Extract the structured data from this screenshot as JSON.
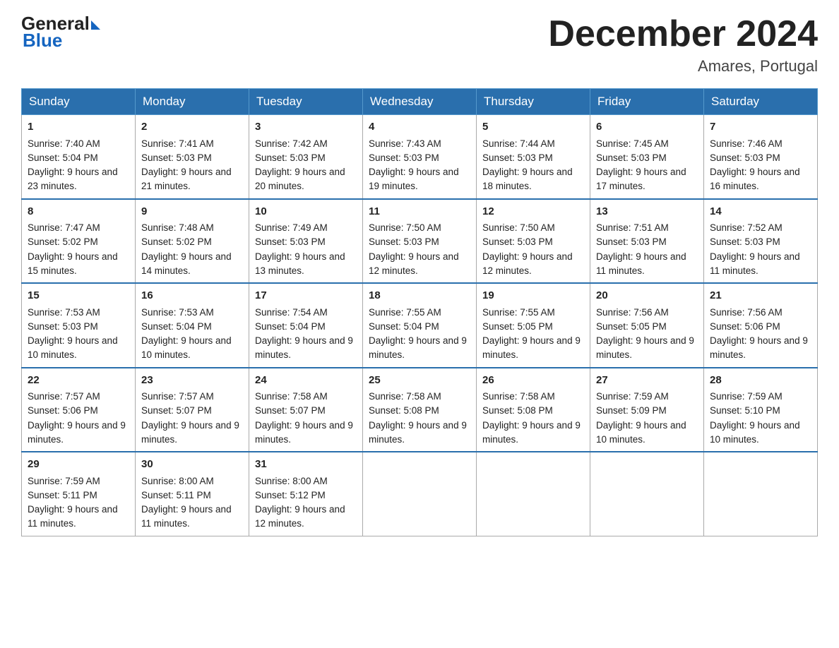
{
  "header": {
    "logo_general": "General",
    "logo_blue": "Blue",
    "month_title": "December 2024",
    "location": "Amares, Portugal"
  },
  "days_of_week": [
    "Sunday",
    "Monday",
    "Tuesday",
    "Wednesday",
    "Thursday",
    "Friday",
    "Saturday"
  ],
  "weeks": [
    [
      {
        "day": 1,
        "sunrise": "7:40 AM",
        "sunset": "5:04 PM",
        "daylight": "9 hours and 23 minutes."
      },
      {
        "day": 2,
        "sunrise": "7:41 AM",
        "sunset": "5:03 PM",
        "daylight": "9 hours and 21 minutes."
      },
      {
        "day": 3,
        "sunrise": "7:42 AM",
        "sunset": "5:03 PM",
        "daylight": "9 hours and 20 minutes."
      },
      {
        "day": 4,
        "sunrise": "7:43 AM",
        "sunset": "5:03 PM",
        "daylight": "9 hours and 19 minutes."
      },
      {
        "day": 5,
        "sunrise": "7:44 AM",
        "sunset": "5:03 PM",
        "daylight": "9 hours and 18 minutes."
      },
      {
        "day": 6,
        "sunrise": "7:45 AM",
        "sunset": "5:03 PM",
        "daylight": "9 hours and 17 minutes."
      },
      {
        "day": 7,
        "sunrise": "7:46 AM",
        "sunset": "5:03 PM",
        "daylight": "9 hours and 16 minutes."
      }
    ],
    [
      {
        "day": 8,
        "sunrise": "7:47 AM",
        "sunset": "5:02 PM",
        "daylight": "9 hours and 15 minutes."
      },
      {
        "day": 9,
        "sunrise": "7:48 AM",
        "sunset": "5:02 PM",
        "daylight": "9 hours and 14 minutes."
      },
      {
        "day": 10,
        "sunrise": "7:49 AM",
        "sunset": "5:03 PM",
        "daylight": "9 hours and 13 minutes."
      },
      {
        "day": 11,
        "sunrise": "7:50 AM",
        "sunset": "5:03 PM",
        "daylight": "9 hours and 12 minutes."
      },
      {
        "day": 12,
        "sunrise": "7:50 AM",
        "sunset": "5:03 PM",
        "daylight": "9 hours and 12 minutes."
      },
      {
        "day": 13,
        "sunrise": "7:51 AM",
        "sunset": "5:03 PM",
        "daylight": "9 hours and 11 minutes."
      },
      {
        "day": 14,
        "sunrise": "7:52 AM",
        "sunset": "5:03 PM",
        "daylight": "9 hours and 11 minutes."
      }
    ],
    [
      {
        "day": 15,
        "sunrise": "7:53 AM",
        "sunset": "5:03 PM",
        "daylight": "9 hours and 10 minutes."
      },
      {
        "day": 16,
        "sunrise": "7:53 AM",
        "sunset": "5:04 PM",
        "daylight": "9 hours and 10 minutes."
      },
      {
        "day": 17,
        "sunrise": "7:54 AM",
        "sunset": "5:04 PM",
        "daylight": "9 hours and 9 minutes."
      },
      {
        "day": 18,
        "sunrise": "7:55 AM",
        "sunset": "5:04 PM",
        "daylight": "9 hours and 9 minutes."
      },
      {
        "day": 19,
        "sunrise": "7:55 AM",
        "sunset": "5:05 PM",
        "daylight": "9 hours and 9 minutes."
      },
      {
        "day": 20,
        "sunrise": "7:56 AM",
        "sunset": "5:05 PM",
        "daylight": "9 hours and 9 minutes."
      },
      {
        "day": 21,
        "sunrise": "7:56 AM",
        "sunset": "5:06 PM",
        "daylight": "9 hours and 9 minutes."
      }
    ],
    [
      {
        "day": 22,
        "sunrise": "7:57 AM",
        "sunset": "5:06 PM",
        "daylight": "9 hours and 9 minutes."
      },
      {
        "day": 23,
        "sunrise": "7:57 AM",
        "sunset": "5:07 PM",
        "daylight": "9 hours and 9 minutes."
      },
      {
        "day": 24,
        "sunrise": "7:58 AM",
        "sunset": "5:07 PM",
        "daylight": "9 hours and 9 minutes."
      },
      {
        "day": 25,
        "sunrise": "7:58 AM",
        "sunset": "5:08 PM",
        "daylight": "9 hours and 9 minutes."
      },
      {
        "day": 26,
        "sunrise": "7:58 AM",
        "sunset": "5:08 PM",
        "daylight": "9 hours and 9 minutes."
      },
      {
        "day": 27,
        "sunrise": "7:59 AM",
        "sunset": "5:09 PM",
        "daylight": "9 hours and 10 minutes."
      },
      {
        "day": 28,
        "sunrise": "7:59 AM",
        "sunset": "5:10 PM",
        "daylight": "9 hours and 10 minutes."
      }
    ],
    [
      {
        "day": 29,
        "sunrise": "7:59 AM",
        "sunset": "5:11 PM",
        "daylight": "9 hours and 11 minutes."
      },
      {
        "day": 30,
        "sunrise": "8:00 AM",
        "sunset": "5:11 PM",
        "daylight": "9 hours and 11 minutes."
      },
      {
        "day": 31,
        "sunrise": "8:00 AM",
        "sunset": "5:12 PM",
        "daylight": "9 hours and 12 minutes."
      },
      null,
      null,
      null,
      null
    ]
  ]
}
